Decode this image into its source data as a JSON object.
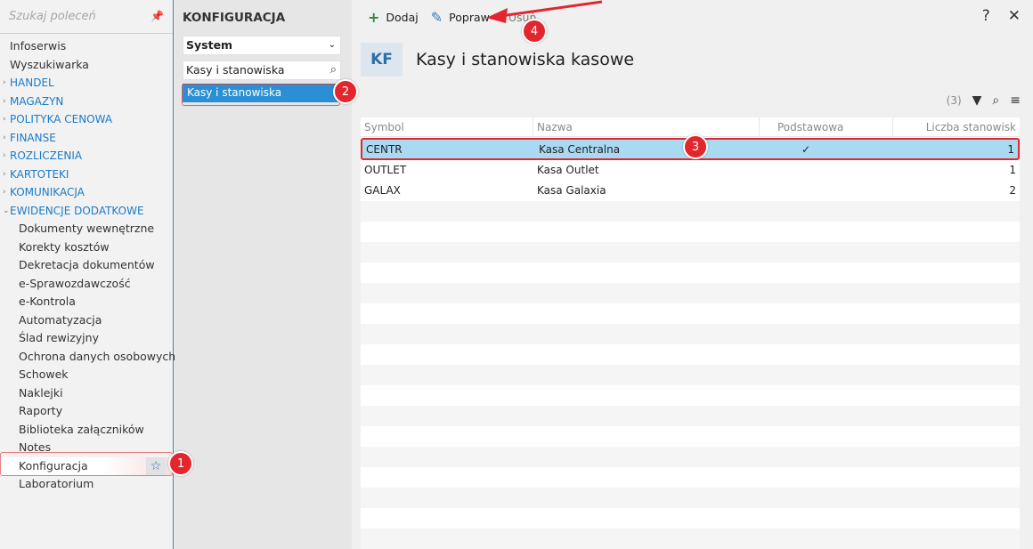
{
  "nav": {
    "search_placeholder": "Szukaj poleceń",
    "top_items": [
      "Infoserwis",
      "Wyszukiwarka"
    ],
    "sections": [
      "HANDEL",
      "MAGAZYN",
      "POLITYKA CENOWA",
      "FINANSE",
      "ROZLICZENIA",
      "KARTOTEKI",
      "KOMUNIKACJA"
    ],
    "expanded_section": "EWIDENCJE DODATKOWE",
    "sub_items": [
      "Dokumenty wewnętrzne",
      "Korekty kosztów",
      "Dekretacja dokumentów",
      "e-Sprawozdawczość",
      "e-Kontrola",
      "Automatyzacja",
      "Ślad rewizyjny",
      "Ochrona danych osobowych",
      "Schowek",
      "Naklejki",
      "Raporty",
      "Biblioteka załączników",
      "Notes",
      "Konfiguracja",
      "Laboratorium"
    ],
    "active_item": "Konfiguracja"
  },
  "config": {
    "title": "KONFIGURACJA",
    "group_select": "System",
    "filter_value": "Kasy i stanowiska",
    "selected_item": "Kasy i stanowiska"
  },
  "toolbar": {
    "add_label": "Dodaj",
    "edit_label": "Popraw",
    "delete_label": "Usuń",
    "help": "?",
    "close": "✕"
  },
  "view": {
    "badge": "KF",
    "title": "Kasy i stanowiska kasowe",
    "count": "(3)"
  },
  "grid": {
    "columns": [
      "Symbol",
      "Nazwa",
      "Podstawowa",
      "Liczba stanowisk"
    ],
    "rows": [
      {
        "symbol": "CENTR",
        "name": "Kasa Centralna",
        "default": "✓",
        "count": "1"
      },
      {
        "symbol": "OUTLET",
        "name": "Kasa Outlet",
        "default": "",
        "count": "1"
      },
      {
        "symbol": "GALAX",
        "name": "Kasa Galaxia",
        "default": "",
        "count": "2"
      }
    ]
  },
  "annotations": [
    "1",
    "2",
    "3",
    "4"
  ],
  "colors": {
    "accent": "#2b8fd6",
    "marker": "#e3262d",
    "selected_row": "#a9daf1"
  }
}
